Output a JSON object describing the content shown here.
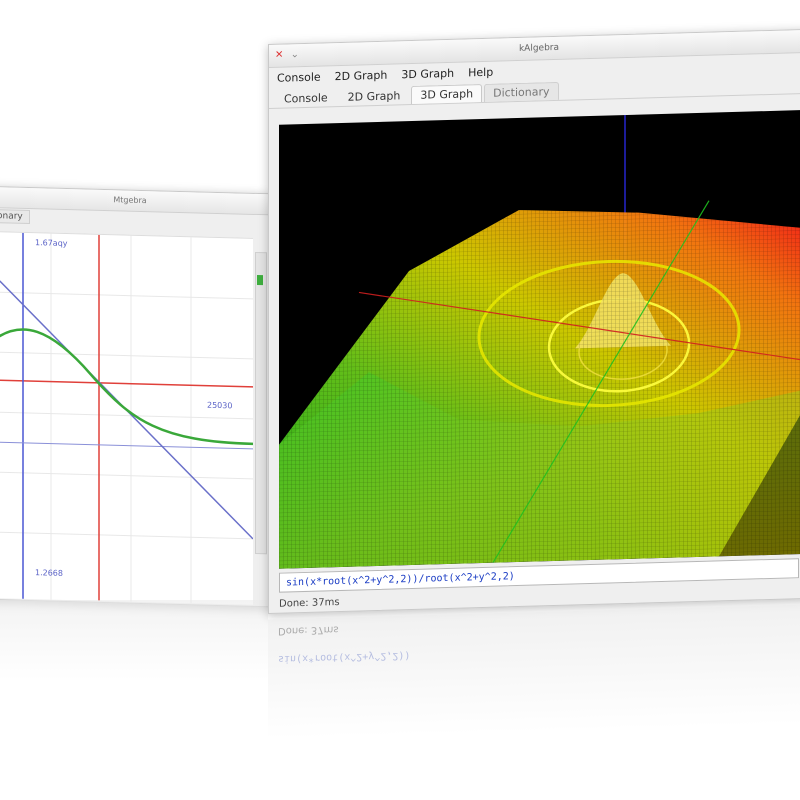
{
  "back_window": {
    "title": "Mtgebra",
    "tab_label": "onary",
    "axis_labels": {
      "y_top": "1.67aqy",
      "x_right": "25030",
      "y_bottom": "1.2668"
    },
    "colors": {
      "curve": "#3aa83a",
      "line": "#5b63c7",
      "red_axis": "#e0403a",
      "blue_axis": "#4a56d4",
      "grid": "#e4e4e4"
    }
  },
  "front_window": {
    "title": "kAlgebra",
    "icons": {
      "close": "close-icon",
      "minimize": "minimize-icon"
    },
    "menu": [
      "Console",
      "2D Graph",
      "3D Graph",
      "Help"
    ],
    "tabs": [
      {
        "label": "Console",
        "active": false
      },
      {
        "label": "2D Graph",
        "active": false
      },
      {
        "label": "3D Graph",
        "active": true
      },
      {
        "label": "Dictionary",
        "active": false
      }
    ],
    "input": {
      "expression": "sin(x*root(x^2+y^2,2))/root(x^2+y^2,2)"
    },
    "status": "Done: 37ms",
    "colors": {
      "surface_red": "#ff2020",
      "surface_yellow": "#e8e000",
      "surface_green": "#28c828",
      "axis_red": "#d02020",
      "axis_green": "#20c020",
      "axis_blue": "#3030ff"
    }
  },
  "reflection": {
    "status": "Done: 37ms",
    "input": "sin(x*root(x^2+y^2,2))"
  }
}
